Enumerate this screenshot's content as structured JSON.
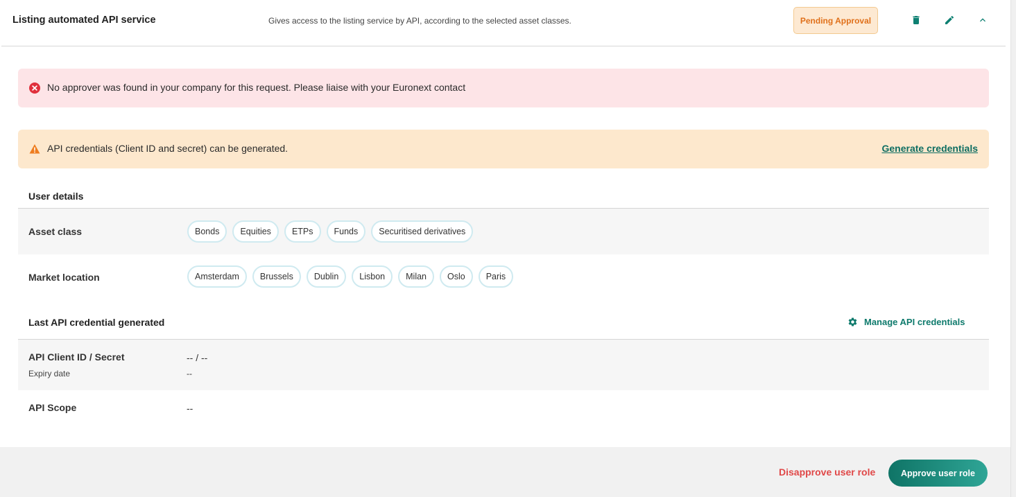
{
  "header": {
    "title": "Listing automated API service",
    "description": "Gives access to the listing service by API, according to the selected asset classes.",
    "status": "Pending Approval",
    "icons": [
      "trash-icon",
      "pencil-icon",
      "chevron-up-icon"
    ]
  },
  "alerts": {
    "error": {
      "icon": "error-circle-icon",
      "text": "No approver was found in your company for this request. Please liaise with your Euronext contact"
    },
    "warning": {
      "icon": "warning-triangle-icon",
      "text": "API credentials (Client ID and secret) can be generated.",
      "link": "Generate credentials"
    }
  },
  "user_details": {
    "title": "User details",
    "asset_class": {
      "label": "Asset class",
      "values": [
        "Bonds",
        "Equities",
        "ETPs",
        "Funds",
        "Securitised derivatives"
      ]
    },
    "market_location": {
      "label": "Market location",
      "values": [
        "Amsterdam",
        "Brussels",
        "Dublin",
        "Lisbon",
        "Milan",
        "Oslo",
        "Paris"
      ]
    }
  },
  "api_credentials": {
    "title": "Last API credential generated",
    "manage_label": "Manage API credentials",
    "client_label": "API Client ID / Secret",
    "client_value": "-- / --",
    "expiry_label": "Expiry date",
    "expiry_value": "--",
    "scope_label": "API Scope",
    "scope_value": "--"
  },
  "footer": {
    "disapprove": "Disapprove user role",
    "approve": "Approve user role"
  },
  "colors": {
    "accent": "#0e7a6c",
    "pending": "#e0701a",
    "error_bg": "#fde4e7",
    "warn_bg": "#fde8cd",
    "danger": "#e04848"
  }
}
